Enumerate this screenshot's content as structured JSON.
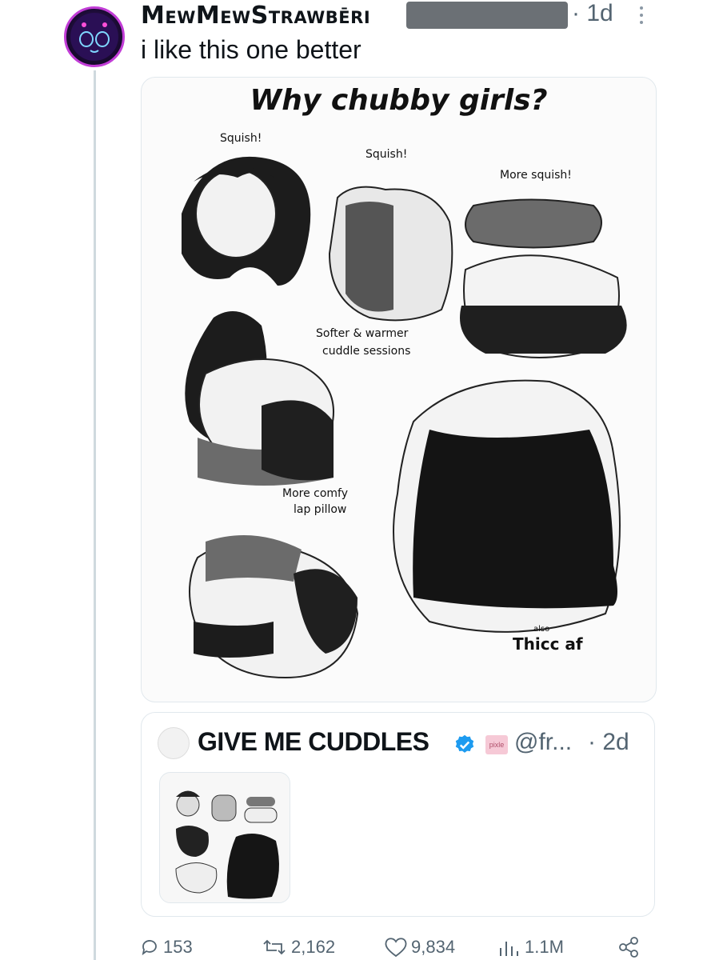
{
  "post": {
    "author": "MewMewStrawbēri",
    "time": "· 1d",
    "text": "i like this one better"
  },
  "media": {
    "title": "Why chubby girls?",
    "labels": {
      "squish1": "Squish!",
      "squish2": "Squish!",
      "more_squish": "More squish!",
      "softer1": "Softer & warmer",
      "softer2": "cuddle sessions",
      "comfy1": "More comfy",
      "comfy2": "lap pillow",
      "also": "also",
      "thicc": "Thicc af"
    }
  },
  "quote": {
    "name": "GIVE ME CUDDLES",
    "badge": "pixle",
    "handle": "@fr...",
    "time": "· 2d"
  },
  "actions": {
    "replies": "153",
    "reposts": "2,162",
    "likes": "9,834",
    "views": "1.1M"
  },
  "icons": {
    "reply": "reply-icon",
    "repost": "repost-icon",
    "like": "heart-icon",
    "views": "views-icon",
    "share": "share-icon",
    "verified": "verified-icon",
    "more": "more-icon"
  },
  "colors": {
    "accent": "#1d9bf0",
    "muted": "#536471",
    "avatar_ring": "#c13cd6"
  }
}
